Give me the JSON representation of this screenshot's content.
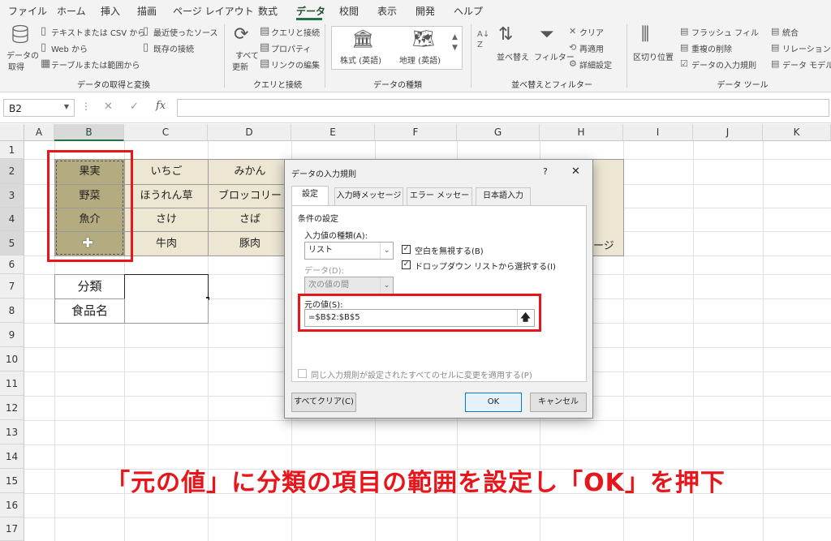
{
  "ribbon_tabs": [
    "ファイル",
    "ホーム",
    "挿入",
    "描画",
    "ページ レイアウト",
    "数式",
    "データ",
    "校閲",
    "表示",
    "開発",
    "ヘルプ"
  ],
  "ribbon": {
    "get_data": {
      "line1": "データの",
      "line2": "取得"
    },
    "from_text_csv": "テキストまたは CSV から",
    "from_web": "Web から",
    "from_table": "テーブルまたは範囲から",
    "recent_sources": "最近使ったソース",
    "existing_connections": "既存の接続",
    "group_get_transform": "データの取得と変換",
    "refresh_all": {
      "line1": "すべて",
      "line2": "更新"
    },
    "queries_connections": "クエリと接続",
    "properties": "プロパティ",
    "edit_links": "リンクの編集",
    "group_queries": "クエリと接続",
    "stocks": "株式 (英語)",
    "geography": "地理 (英語)",
    "group_data_types": "データの種類",
    "sort": "並べ替え",
    "filter": "フィルター",
    "clear": "クリア",
    "reapply": "再適用",
    "advanced": "詳細設定",
    "group_sort_filter": "並べ替えとフィルター",
    "text_to_columns": "区切り位置",
    "flash_fill": "フラッシュ フィル",
    "remove_duplicates": "重複の削除",
    "data_validation": "データの入力規則",
    "consolidate": "統合",
    "relationships": "リレーションシップ",
    "data_model": "データ モデル",
    "group_data_tools": "データ ツール"
  },
  "formula_bar": {
    "name_box": "B2",
    "formula": ""
  },
  "columns": [
    "A",
    "B",
    "C",
    "D",
    "E",
    "F",
    "G",
    "H",
    "I",
    "J",
    "K"
  ],
  "rows": [
    "1",
    "2",
    "3",
    "4",
    "5",
    "6",
    "7",
    "8",
    "9",
    "10",
    "11",
    "12",
    "13",
    "14",
    "15",
    "16",
    "17"
  ],
  "table": {
    "categories": [
      "果実",
      "野菜",
      "魚介",
      ""
    ],
    "col_c": [
      "いちご",
      "ほうれん草",
      "さけ",
      "牛肉"
    ],
    "col_d": [
      "みかん",
      "ブロッコリー",
      "さば",
      "豚肉"
    ],
    "h5_partial": "ージ"
  },
  "form": {
    "label_category": "分類",
    "label_food": "食品名"
  },
  "dialog": {
    "title": "データの入力規則",
    "help": "?",
    "close": "✕",
    "tabs": [
      "設定",
      "入力時メッセージ",
      "エラー メッセージ",
      "日本語入力"
    ],
    "section": "条件の設定",
    "allow_label": "入力値の種類(A):",
    "allow_value": "リスト",
    "ignore_blank": "空白を無視する(B)",
    "dropdown": "ドロップダウン リストから選択する(I)",
    "data_label": "データ(D):",
    "data_value": "次の値の間",
    "source_label": "元の値(S):",
    "source_value": "=$B$2:$B$5",
    "apply_all": "同じ入力規則が設定されたすべてのセルに変更を適用する(P)",
    "clear_all": "すべてクリア(C)",
    "ok": "OK",
    "cancel": "キャンセル"
  },
  "caption": "「元の値」に分類の項目の範囲を設定し「OK」を押下",
  "colors": {
    "accent": "#217346",
    "highlight": "#e8151b",
    "caption": "#e8151b"
  }
}
